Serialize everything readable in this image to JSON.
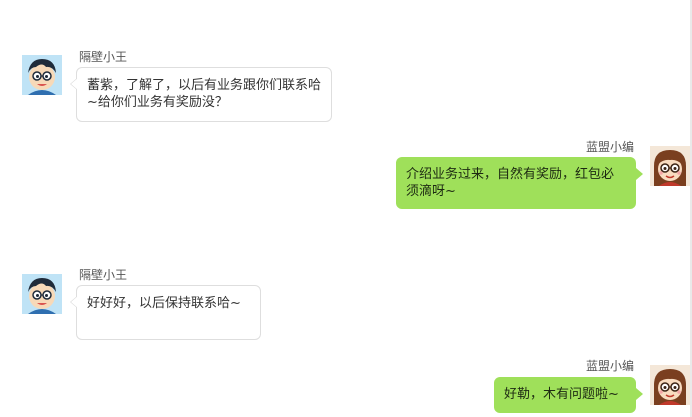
{
  "colors": {
    "outgoing_bubble": "#9fe05a",
    "incoming_bubble": "#ffffff",
    "incoming_border": "#dedede"
  },
  "messages": [
    {
      "sender": "隔壁小王",
      "side": "left",
      "avatar": "boy-avatar-icon",
      "text": "蓄紫，了解了，以后有业务跟你们联系哈~给你们业务有奖励没？"
    },
    {
      "sender": "蓝盟小编",
      "side": "right",
      "avatar": "girl-avatar-icon",
      "text": "介绍业务过来，自然有奖励，红包必须滴呀~"
    },
    {
      "sender": "隔壁小王",
      "side": "left",
      "avatar": "boy-avatar-icon",
      "text": "好好好，以后保持联系哈~"
    },
    {
      "sender": "蓝盟小编",
      "side": "right",
      "avatar": "girl-avatar-icon",
      "text": "好勒，木有问题啦~"
    }
  ]
}
